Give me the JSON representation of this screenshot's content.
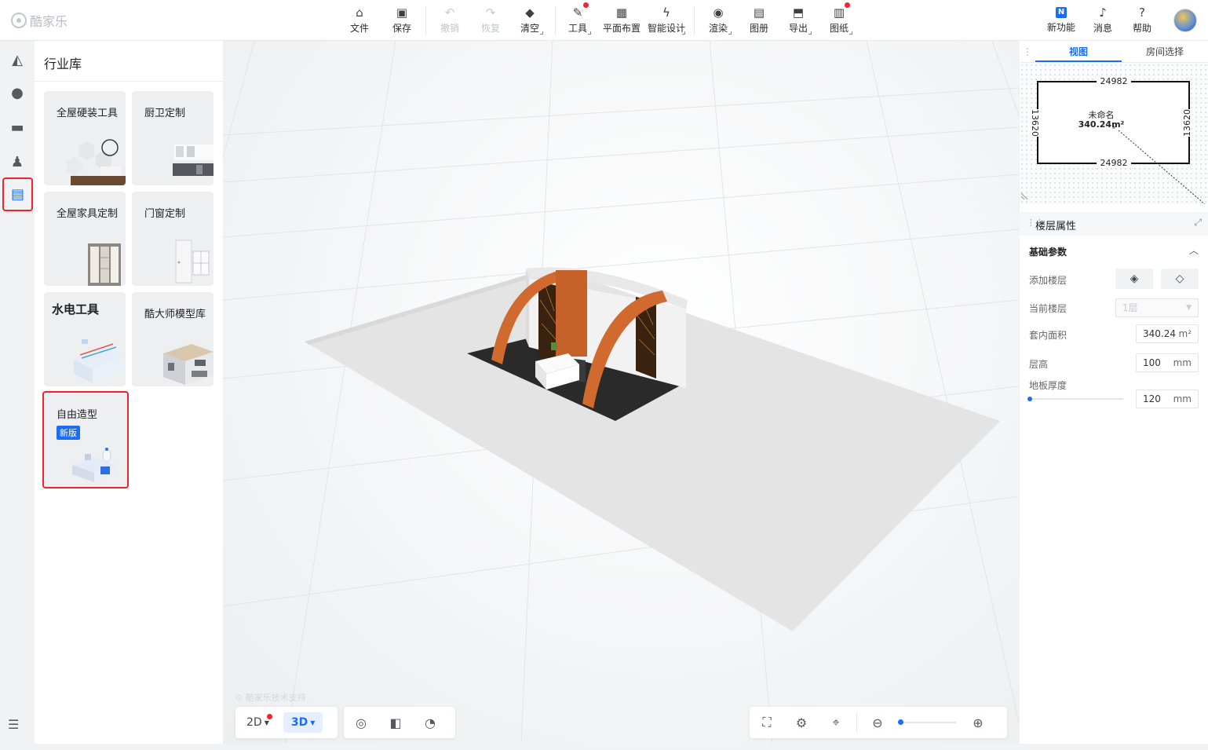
{
  "app": {
    "name": "酷家乐"
  },
  "toolbar": {
    "items": [
      {
        "label": "文件",
        "icon": "home-file-icon"
      },
      {
        "label": "保存",
        "icon": "save-icon"
      },
      {
        "label": "撤销",
        "icon": "undo-icon"
      },
      {
        "label": "恢复",
        "icon": "redo-icon"
      },
      {
        "label": "清空",
        "icon": "eraser-icon"
      },
      {
        "label": "工具",
        "icon": "wrench-icon"
      },
      {
        "label": "平面布置",
        "icon": "floorplan-icon"
      },
      {
        "label": "智能设计",
        "icon": "lightning-icon"
      },
      {
        "label": "渲染",
        "icon": "camera-icon"
      },
      {
        "label": "图册",
        "icon": "album-icon"
      },
      {
        "label": "导出",
        "icon": "export-icon"
      },
      {
        "label": "图纸",
        "icon": "drawing-icon"
      }
    ],
    "right": [
      {
        "label": "新功能",
        "icon": "new-feature-icon",
        "badge": "N"
      },
      {
        "label": "消息",
        "icon": "bell-icon"
      },
      {
        "label": "帮助",
        "icon": "help-icon"
      }
    ]
  },
  "library": {
    "title": "行业库",
    "cards": [
      {
        "label": "全屋硬装工具"
      },
      {
        "label": "厨卫定制"
      },
      {
        "label": "全屋家具定制"
      },
      {
        "label": "门窗定制"
      },
      {
        "label": "水电工具"
      },
      {
        "label": "酷大师模型库"
      },
      {
        "label": "自由造型",
        "tag": "新版"
      }
    ]
  },
  "viewport": {
    "credit": "酷家乐技术支持",
    "modes": [
      "2D",
      "3D"
    ],
    "active_mode": "3D"
  },
  "right_panel": {
    "tabs": [
      "视图",
      "房间选择"
    ],
    "active_tab": "视图",
    "minimap": {
      "room_name": "未命名",
      "room_area": "340.24m²",
      "dim_top": "24982",
      "dim_bottom": "24982",
      "dim_left": "13620",
      "dim_right": "13620"
    },
    "props_title": "楼层属性",
    "section_title": "基础参数",
    "add_floor_label": "添加楼层",
    "current_floor_label": "当前楼层",
    "current_floor_value": "1层",
    "area_label": "套内面积",
    "area_value": "340.24",
    "area_unit": "m²",
    "height_label": "层高",
    "height_value": "100",
    "height_unit": "mm",
    "thickness_label": "地板厚度",
    "thickness_value": "120",
    "thickness_unit": "mm"
  },
  "colors": {
    "accent": "#1b6ef3",
    "highlight": "#f0232a",
    "badge_red": "#f5222d",
    "booth_orange": "#d06a2e"
  }
}
